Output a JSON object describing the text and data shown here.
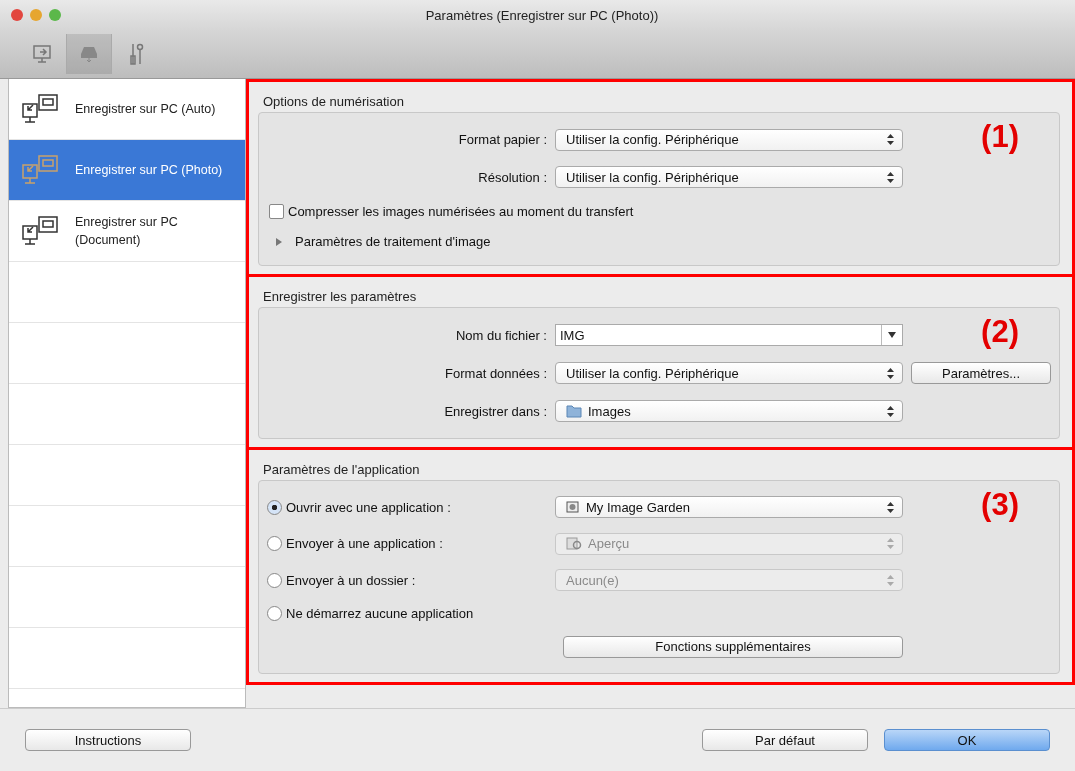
{
  "window": {
    "title": "Paramètres (Enregistrer sur PC (Photo))"
  },
  "sidebar": {
    "items": [
      {
        "label": "Enregistrer sur PC (Auto)",
        "selected": false
      },
      {
        "label": "Enregistrer sur PC (Photo)",
        "selected": true
      },
      {
        "label": "Enregistrer sur PC (Document)",
        "selected": false
      }
    ]
  },
  "sections": [
    {
      "title": "Options de numérisation",
      "marker": "(1)",
      "rows": [
        {
          "kind": "select",
          "label": "Format papier :",
          "value": "Utiliser la config. Périphérique"
        },
        {
          "kind": "select",
          "label": "Résolution :",
          "value": "Utiliser la config. Périphérique"
        },
        {
          "kind": "checkbox",
          "label": "Compresser les images numérisées au moment du transfert",
          "checked": false
        },
        {
          "kind": "disclosure",
          "label": "Paramètres de traitement d'image",
          "expanded": false
        }
      ]
    },
    {
      "title": "Enregistrer les paramètres",
      "marker": "(2)",
      "rows": [
        {
          "kind": "combo",
          "label": "Nom du fichier :",
          "value": "IMG"
        },
        {
          "kind": "select",
          "label": "Format données :",
          "value": "Utiliser la config. Périphérique",
          "button": "Paramètres..."
        },
        {
          "kind": "select",
          "label": "Enregistrer dans :",
          "value": "Images"
        }
      ]
    },
    {
      "title": "Paramètres de l'application",
      "marker": "(3)",
      "rows": [
        {
          "kind": "radio",
          "label": "Ouvrir avec une application :",
          "selected": true,
          "value": "My Image Garden",
          "disabled": false
        },
        {
          "kind": "radio",
          "label": "Envoyer à une application :",
          "selected": false,
          "value": "Aperçu",
          "disabled": true
        },
        {
          "kind": "radio",
          "label": "Envoyer à un dossier :",
          "selected": false,
          "value": "Aucun(e)",
          "disabled": true
        },
        {
          "kind": "radio",
          "label": "Ne démarrez aucune application",
          "selected": false
        },
        {
          "kind": "button",
          "label": "Fonctions supplémentaires"
        }
      ]
    }
  ],
  "footer": {
    "left_button": "Instructions",
    "buttons": [
      {
        "label": "Par défaut",
        "default": false
      },
      {
        "label": "OK",
        "default": true
      }
    ]
  }
}
